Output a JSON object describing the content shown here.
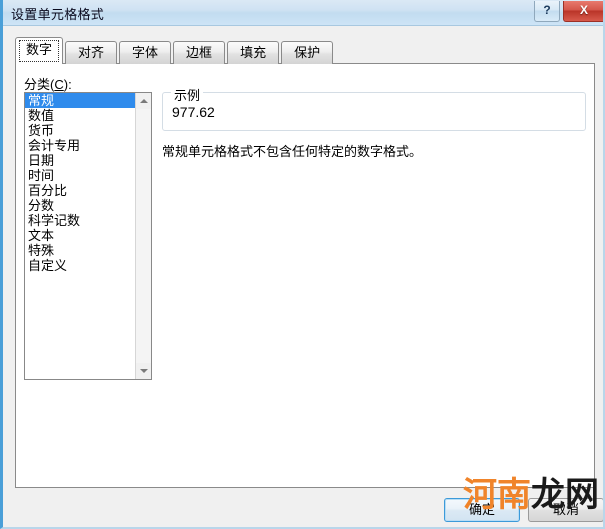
{
  "window": {
    "title": "设置单元格格式",
    "help_button": "?",
    "close_button": "X",
    "accent_color": "#4a9fd8",
    "titlebar_color": "#cfe2f3",
    "close_color": "#ba3428"
  },
  "tabs": [
    {
      "label": "数字",
      "active": true
    },
    {
      "label": "对齐",
      "active": false
    },
    {
      "label": "字体",
      "active": false
    },
    {
      "label": "边框",
      "active": false
    },
    {
      "label": "填充",
      "active": false
    },
    {
      "label": "保护",
      "active": false
    }
  ],
  "category": {
    "label_prefix": "分类(",
    "label_accesskey": "C",
    "label_suffix": "):",
    "selected": "常规",
    "selection_color": "#2f8bec",
    "items": [
      "常规",
      "数值",
      "货币",
      "会计专用",
      "日期",
      "时间",
      "百分比",
      "分数",
      "科学记数",
      "文本",
      "特殊",
      "自定义"
    ]
  },
  "scrollbar": {
    "up_arrow": "scroll-up-arrow",
    "down_arrow": "scroll-down-arrow"
  },
  "sample": {
    "legend": "示例",
    "value": "977.62"
  },
  "description": "常规单元格格式不包含任何特定的数字格式。",
  "buttons": {
    "ok": "确定",
    "cancel": "取消"
  },
  "watermark": {
    "part_a": "河南",
    "part_b": "龙网",
    "color_a": "#f0842a",
    "color_b": "#1a1a1a"
  }
}
